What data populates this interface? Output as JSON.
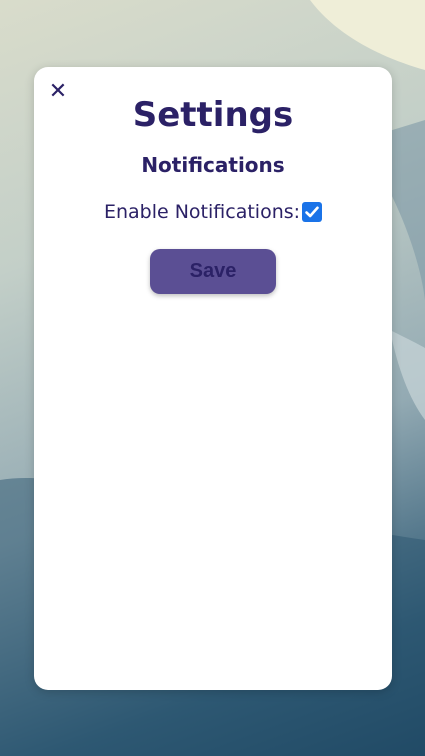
{
  "dialog": {
    "close_icon": "close-icon",
    "close_glyph": "✕",
    "title": "Settings",
    "section_heading": "Notifications",
    "enable_notifications_label": "Enable Notifications:",
    "enable_notifications_checked": true,
    "save_label": "Save"
  },
  "colors": {
    "text": "#2b2166",
    "button": "#5b4f94",
    "checkbox": "#1a73e8",
    "card": "#ffffff"
  }
}
